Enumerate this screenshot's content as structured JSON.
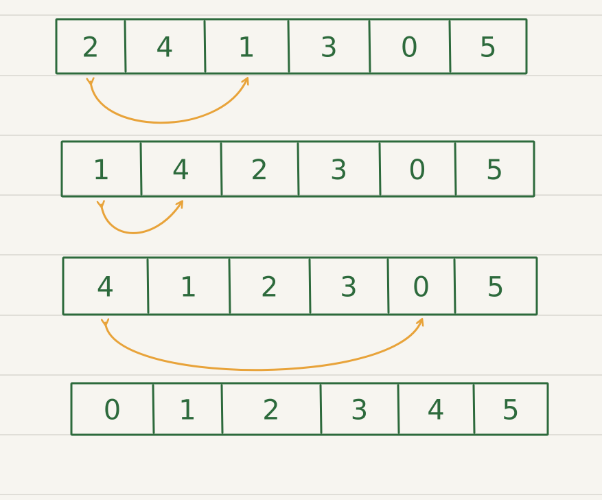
{
  "colors": {
    "background": "#f7f5f0",
    "ruled_line": "#d9d6d0",
    "box_stroke": "#2d6a3c",
    "digit": "#2d6a3c",
    "arrow": "#e8a33a"
  },
  "rows": [
    {
      "cells": [
        "2",
        "4",
        "1",
        "3",
        "0",
        "5"
      ],
      "swap": [
        0,
        2
      ]
    },
    {
      "cells": [
        "1",
        "4",
        "2",
        "3",
        "0",
        "5"
      ],
      "swap": [
        0,
        1
      ]
    },
    {
      "cells": [
        "4",
        "1",
        "2",
        "3",
        "0",
        "5"
      ],
      "swap": [
        0,
        4
      ]
    },
    {
      "cells": [
        "0",
        "1",
        "2",
        "3",
        "4",
        "5"
      ],
      "swap": null
    }
  ]
}
